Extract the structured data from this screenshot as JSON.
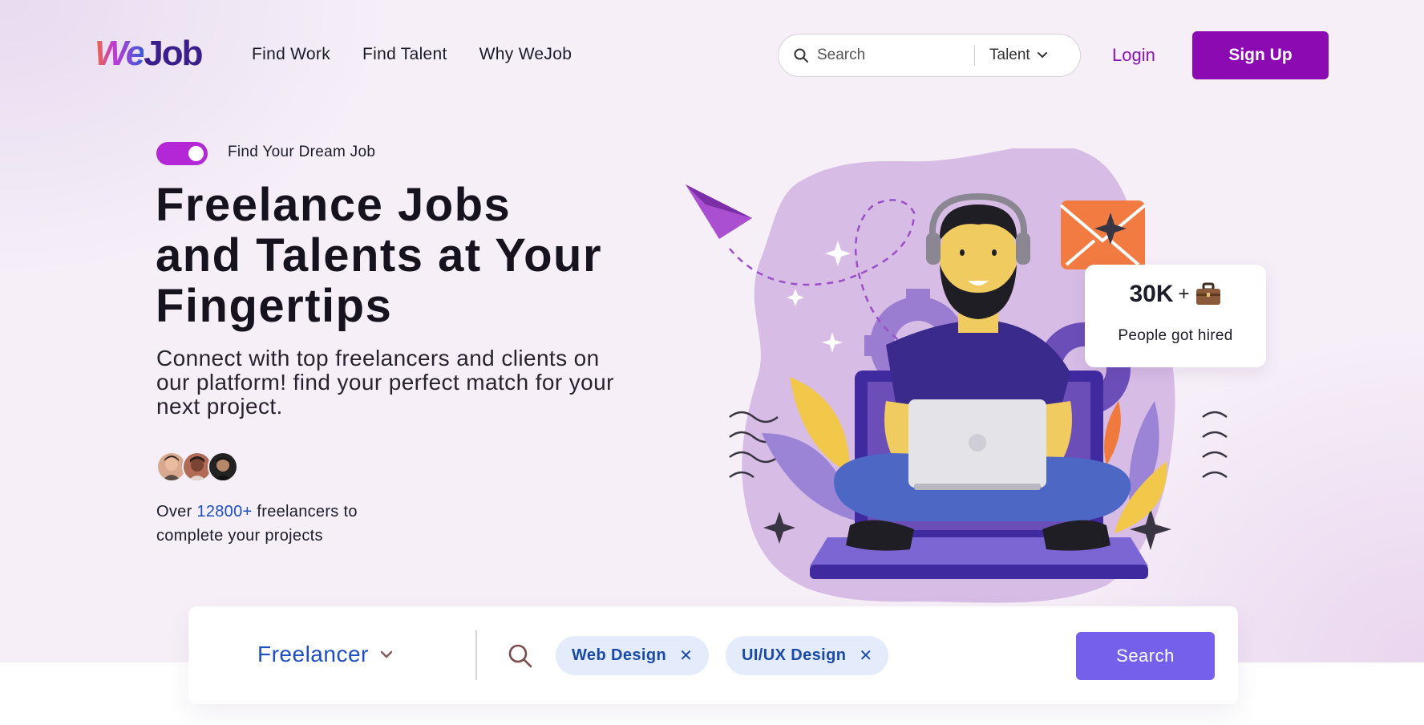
{
  "brand": {
    "logo_we": "We",
    "logo_job": "Job"
  },
  "nav": {
    "links": [
      "Find Work",
      "Find Talent",
      "Why WeJob"
    ],
    "search_placeholder": "Search",
    "search_category": "Talent",
    "login_label": "Login",
    "signup_label": "Sign Up"
  },
  "hero": {
    "toggle_label": "Find Your Dream Job",
    "toggle_on": true,
    "title_lines": [
      "Freelance Jobs",
      "and Talents at Your",
      "Fingertips"
    ],
    "subtitle": "Connect with top freelancers and clients on our platform! find your perfect match for your next project.",
    "freelancer_prefix": "Over ",
    "freelancer_count": "12800+",
    "freelancer_suffix": " freelancers to complete your projects"
  },
  "stat_card": {
    "value": "30K",
    "plus": "+",
    "icon": "briefcase-icon",
    "label": "People got hired"
  },
  "search_panel": {
    "role": "Freelancer",
    "chips": [
      "Web Design",
      "UI/UX Design"
    ],
    "search_label": "Search"
  },
  "colors": {
    "brand_purple": "#8b0ab2",
    "toggle": "#b327d6",
    "link_blue": "#1d4fc4",
    "search_button": "#7560ec",
    "chip_bg": "#e4ecfb"
  }
}
